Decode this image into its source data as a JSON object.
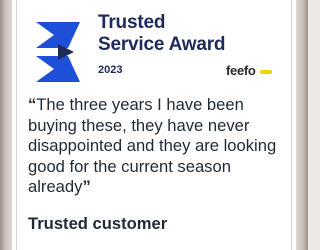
{
  "award": {
    "title_line1": "Trusted",
    "title_line2": "Service Award",
    "year": "2023",
    "provider": "feefo",
    "logo_icon": "feefo-trusted-mark-icon",
    "colors": {
      "navy": "#1f2a5c",
      "blue": "#1e4fd8",
      "yellow": "#f3d400"
    }
  },
  "review": {
    "open_quote": "“",
    "text": "The three years I have been buying these, they have never disappointed and they are looking good for the current season already",
    "close_quote": "”",
    "author": "Trusted customer"
  }
}
